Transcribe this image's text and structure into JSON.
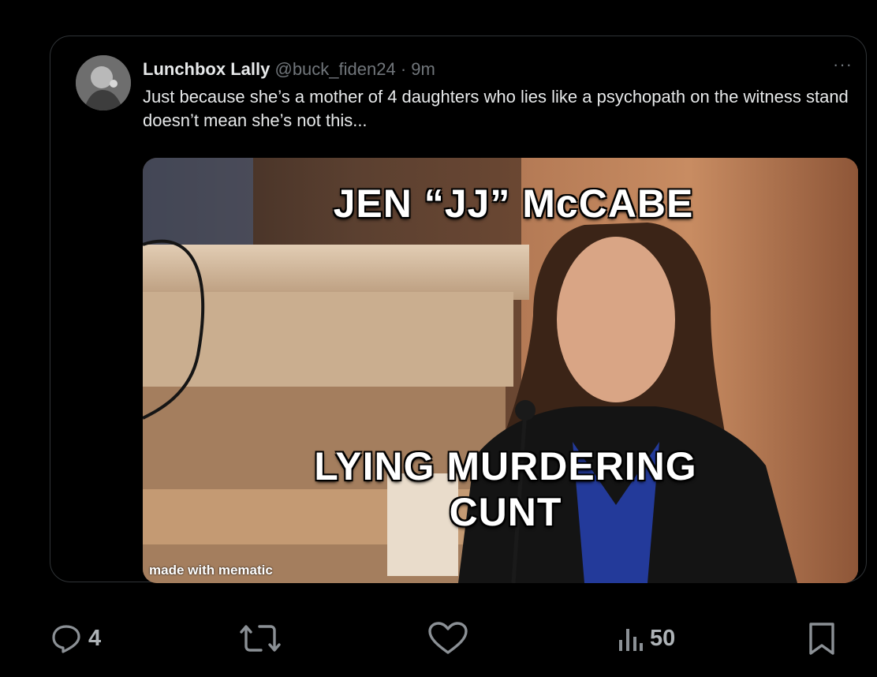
{
  "tweet": {
    "author_name": "Lunchbox Lally",
    "handle": "@buck_fiden24",
    "separator": "·",
    "time": "9m",
    "text": "Just because she’s a mother of 4 daughters who lies like a psychopath on the witness stand doesn’t mean she’s not this..."
  },
  "media": {
    "caption_top": "JEN “JJ” McCABE",
    "caption_bottom_line1": "LYING MURDERING",
    "caption_bottom_line2": "CUNT",
    "watermark": "made with mematic"
  },
  "actions": {
    "replies": "4",
    "views": "50"
  },
  "icons": [
    "more-options-icon",
    "reply-icon",
    "retweet-icon",
    "like-icon",
    "views-icon",
    "bookmark-icon"
  ],
  "colors": {
    "background": "#000000",
    "text": "#e7e9ea",
    "muted": "#71767b",
    "border": "#2f3336"
  }
}
